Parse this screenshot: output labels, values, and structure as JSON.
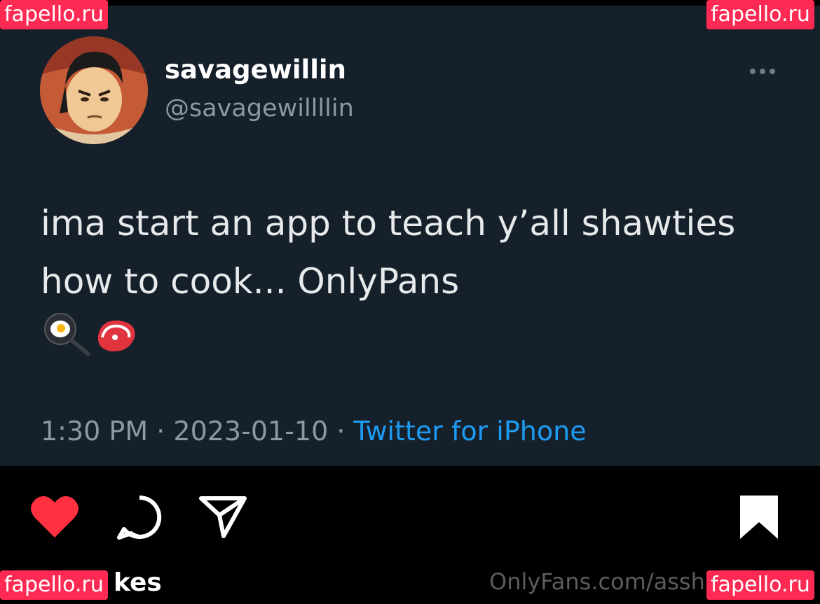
{
  "tweet": {
    "display_name": "savagewillin",
    "handle": "@savagewillllin",
    "text": "ima start an app to teach y’all shawties how to cook... OnlyPans",
    "emojis": [
      "frying-pan-egg",
      "cut-of-meat"
    ],
    "time": "1:30 PM",
    "date": "2023-01-10",
    "separator": "·",
    "source": "Twitter for iPhone",
    "more_icon": "..."
  },
  "post_actions": {
    "like_icon": "heart-icon",
    "comment_icon": "comment-icon",
    "share_icon": "send-icon",
    "save_icon": "bookmark-icon",
    "like_color": "#ff3040"
  },
  "footer": {
    "likes_text": "kes",
    "credit": "OnlyFans.com/asshl"
  },
  "watermark": {
    "text": "fapello.ru",
    "color": "#ff2a53"
  },
  "colors": {
    "tweet_bg": "#15202b",
    "page_bg": "#000000",
    "link": "#1d9bf0",
    "muted": "#8b98a5"
  }
}
